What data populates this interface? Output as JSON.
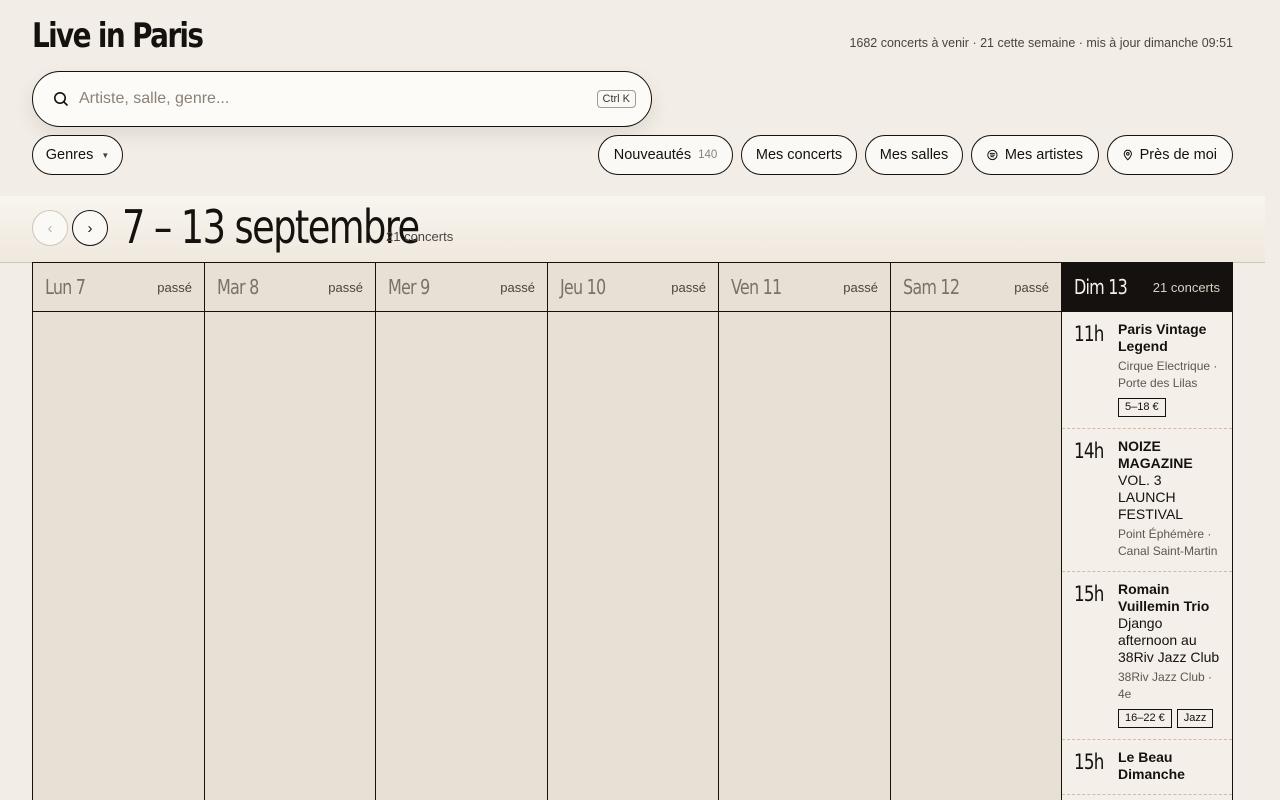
{
  "header": {
    "title": "Live in Paris",
    "stats": "1682 concerts à venir · 21 cette semaine · mis à jour dimanche 09:51"
  },
  "search": {
    "placeholder": "Artiste, salle, genre...",
    "shortcut": "Ctrl K"
  },
  "filters": {
    "genres_label": "Genres",
    "new_label": "Nouveautés",
    "new_count": "140",
    "my_concerts": "Mes concerts",
    "my_venues": "Mes salles",
    "my_artists": "Mes artistes",
    "near_me": "Près de moi"
  },
  "week": {
    "prev_label": "‹",
    "next_label": "›",
    "title": "7 – 13 septembre",
    "count": "21 concerts"
  },
  "days": [
    {
      "name": "Lun 7",
      "tag": "passé"
    },
    {
      "name": "Mar 8",
      "tag": "passé"
    },
    {
      "name": "Mer 9",
      "tag": "passé"
    },
    {
      "name": "Jeu 10",
      "tag": "passé"
    },
    {
      "name": "Ven 11",
      "tag": "passé"
    },
    {
      "name": "Sam 12",
      "tag": "passé"
    },
    {
      "name": "Dim 13",
      "tag": "21 concerts"
    }
  ],
  "events": [
    {
      "time": "11h",
      "title": "Paris Vintage Legend",
      "subtitle": "",
      "venue": "Cirque Electrique · Porte des Lilas",
      "tags": [
        "5–18 €"
      ]
    },
    {
      "time": "14h",
      "title": "NOIZE MAGAZINE",
      "subtitle": "VOL. 3 LAUNCH FESTIVAL",
      "venue": "Point Éphémère · Canal Saint-Martin",
      "tags": []
    },
    {
      "time": "15h",
      "title": "Romain Vuillemin Trio",
      "subtitle": "Django afternoon au 38Riv Jazz Club",
      "venue": "38Riv Jazz Club · 4e",
      "tags": [
        "16–22 €",
        "Jazz"
      ]
    },
    {
      "time": "15h",
      "title": "Le Beau Dimanche",
      "subtitle": "",
      "venue": "",
      "tags": []
    }
  ]
}
